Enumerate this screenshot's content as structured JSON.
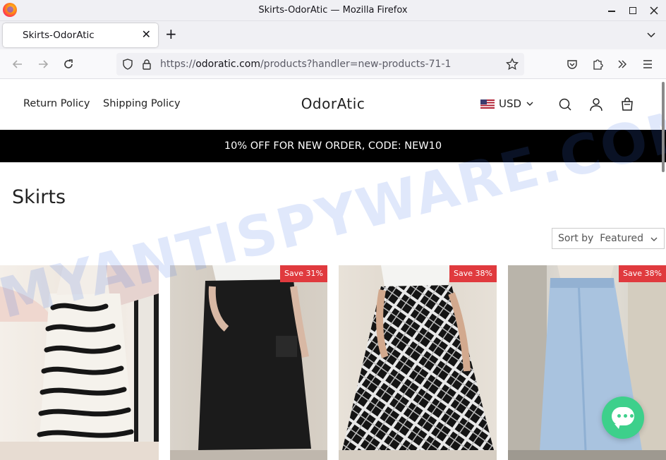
{
  "window": {
    "title": "Skirts-OdorAtic — Mozilla Firefox",
    "controls": {
      "minimize": "—",
      "maximize": "☐",
      "close": "✕"
    }
  },
  "tabs": [
    {
      "label": "Skirts-OdorAtic",
      "close": "✕"
    }
  ],
  "newtab": "+",
  "address": {
    "scheme": "https://",
    "host": "odoratic.com",
    "path": "/products?handler=new-products-71-1"
  },
  "site": {
    "nav": [
      "Return Policy",
      "Shipping Policy"
    ],
    "logo": "OdorAtic",
    "currency": "USD",
    "announcement": "10% OFF FOR NEW ORDER, CODE: NEW10",
    "collection_title": "Skirts",
    "sort": {
      "label": "Sort by",
      "value": "Featured"
    }
  },
  "products": [
    {
      "badge": "",
      "image": "zebra-print-midi-skirt"
    },
    {
      "badge": "Save 31%",
      "image": "black-cargo-midi-skirt"
    },
    {
      "badge": "Save 38%",
      "image": "plaid-a-line-skirt"
    },
    {
      "badge": "Save 38%",
      "image": "denim-maxi-skirt"
    }
  ],
  "watermark": "MYANTISPYWARE.COM",
  "colors": {
    "accent": "#e03a3e",
    "chat": "#3dd08b",
    "announce_bg": "#000000"
  }
}
